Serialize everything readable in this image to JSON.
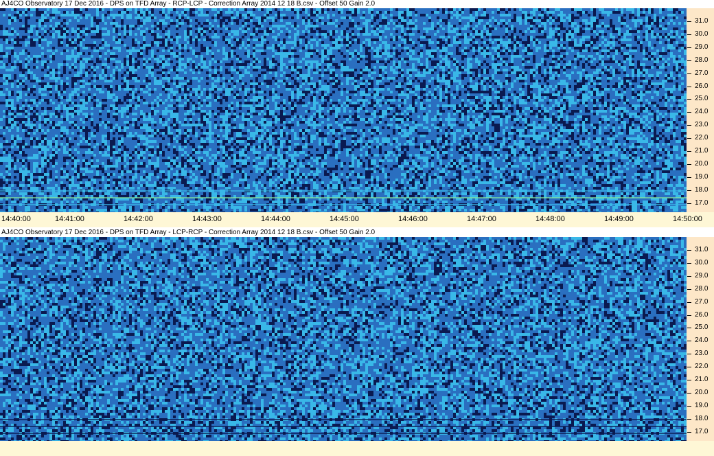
{
  "panels": [
    {
      "title": "AJ4CO Observatory 17 Dec 2016  -  DPS on TFD Array  -  RCP-LCP  -  Correction Array 2014 12 18 B.csv  -  Offset 50  Gain 2.0",
      "mode": "bright",
      "y_ticks": [
        "31.0",
        "30.0",
        "29.0",
        "28.0",
        "27.0",
        "26.0",
        "25.0",
        "24.0",
        "23.0",
        "22.0",
        "21.0",
        "20.0",
        "19.0",
        "18.0",
        "17.0"
      ]
    },
    {
      "title": "AJ4CO Observatory 17 Dec 2016  -  DPS on TFD Array  -  LCP-RCP  -  Correction Array 2014 12 18 B.csv  -  Offset 50  Gain 2.0",
      "mode": "dark",
      "y_ticks": [
        "31.0",
        "30.0",
        "29.0",
        "28.0",
        "27.0",
        "26.0",
        "25.0",
        "24.0",
        "23.0",
        "22.0",
        "21.0",
        "20.0",
        "19.0",
        "18.0",
        "17.0"
      ]
    }
  ],
  "x_ticks": [
    "14:40:00",
    "14:41:00",
    "14:42:00",
    "14:43:00",
    "14:44:00",
    "14:45:00",
    "14:46:00",
    "14:47:00",
    "14:48:00",
    "14:49:00",
    "14:50:00"
  ],
  "colors": {
    "base": "#2a6fc0",
    "dark": "#0a1a50",
    "light": "#39b8e8",
    "bright": "#7fe3a0",
    "axis_bg": "#fde7c8",
    "xaxis_bg": "#fef7d6"
  }
}
